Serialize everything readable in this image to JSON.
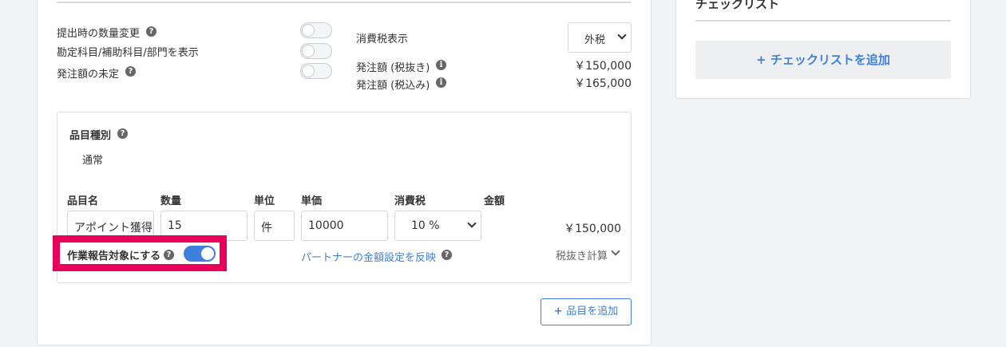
{
  "settings": {
    "qty_change_label": "提出時の数量変更",
    "account_label": "勘定科目/補助科目/部門を表示",
    "undecided_label": "発注額の未定",
    "toggles": {
      "qty_change": false,
      "account": false,
      "undecided": false
    }
  },
  "tax": {
    "label": "消費税表示",
    "mode": "外税",
    "excl_label": "発注額 (税抜き)",
    "excl_amount": "￥150,000",
    "incl_label": "発注額 (税込み)",
    "incl_amount": "￥165,000"
  },
  "item": {
    "type_label": "品目種別",
    "type_value": "通常",
    "headers": {
      "name": "品目名",
      "qty": "数量",
      "unit": "単位",
      "price": "単価",
      "tax": "消費税",
      "amount": "金額"
    },
    "name": "アポイント獲得",
    "qty": "15",
    "unit": "件",
    "price": "10000",
    "tax_rate": "10 %",
    "amount": "￥150,000",
    "report_label": "作業報告対象にする",
    "report_enabled": true,
    "partner_link": "パートナーの金額設定を反映",
    "calc_mode": "税抜き計算"
  },
  "add_item_button": "品目を追加",
  "sidebar": {
    "title": "チェックリスト",
    "add_button": "チェックリストを追加"
  },
  "colors": {
    "accent": "#3f7fde",
    "highlight": "#e8005a"
  }
}
